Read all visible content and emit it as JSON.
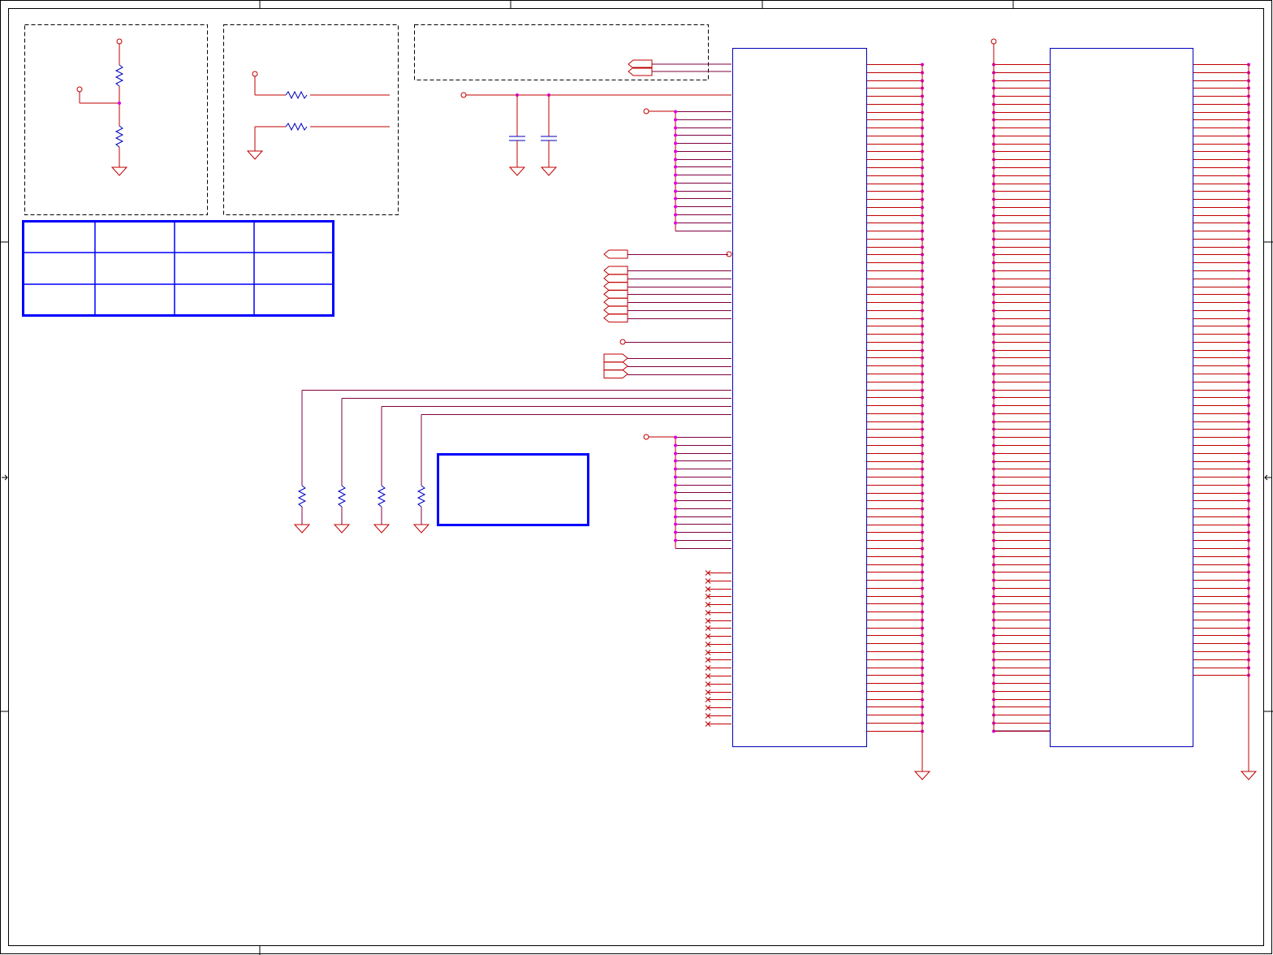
{
  "sheet": {
    "title": "",
    "border_markers": {
      "left_arrow_icon": "arrow-left",
      "right_arrow_icon": "arrow-left"
    }
  },
  "colors": {
    "wire": "#c00000",
    "wire_purple": "#800040",
    "junction": "#e000e0",
    "component_blue": "#0000c0",
    "box_blue": "#0000ff",
    "frame": "#000000",
    "dashed": "#000000"
  },
  "components": {
    "divider_circuit": {
      "resistor_count": 2
    },
    "series_resistors": {
      "resistor_count": 2
    },
    "decoupling_caps": {
      "capacitor_count": 2
    },
    "pulldown_resistors": {
      "count": 4
    },
    "connector_left": {
      "pin_rows": 85
    },
    "connector_right": {
      "pin_rows": 85
    }
  },
  "info_table": {
    "rows": [
      [
        "",
        "",
        "",
        ""
      ],
      [
        "",
        "",
        "",
        ""
      ],
      [
        "",
        "",
        "",
        ""
      ]
    ]
  },
  "note_box": {
    "text": ""
  }
}
